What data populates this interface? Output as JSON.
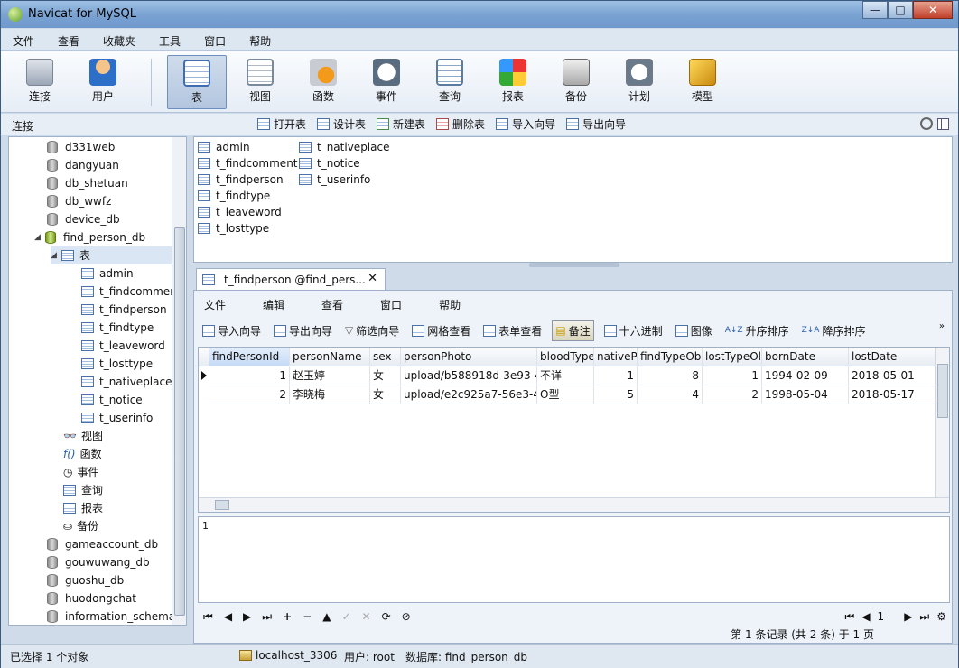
{
  "window": {
    "title": "Navicat for MySQL",
    "minimize": "—",
    "maximize": "□",
    "close": "✕"
  },
  "menu": [
    "文件",
    "查看",
    "收藏夹",
    "工具",
    "窗口",
    "帮助"
  ],
  "toolbar": {
    "connect": "连接",
    "user": "用户",
    "table": "表",
    "view": "视图",
    "function": "函数",
    "event": "事件",
    "query": "查询",
    "report": "报表",
    "backup": "备份",
    "schedule": "计划",
    "model": "模型"
  },
  "conn_bar": {
    "title": "连接",
    "tools": [
      "打开表",
      "设计表",
      "新建表",
      "删除表",
      "导入向导",
      "导出向导"
    ]
  },
  "sidebar": {
    "databases_top": [
      "d331web",
      "dangyuan",
      "db_shetuan",
      "db_wwfz",
      "device_db"
    ],
    "open_db": "find_person_db",
    "tables_node": "表",
    "tables": [
      "admin",
      "t_findcomment",
      "t_findperson",
      "t_findtype",
      "t_leaveword",
      "t_losttype",
      "t_nativeplace",
      "t_notice",
      "t_userinfo"
    ],
    "other_nodes": [
      "视图",
      "函数",
      "事件",
      "查询",
      "报表",
      "备份"
    ],
    "databases_bottom": [
      "gameaccount_db",
      "gouwuwang_db",
      "guoshu_db",
      "huodongchat",
      "information_schema"
    ]
  },
  "objects": {
    "col1": [
      "admin",
      "t_findcomment",
      "t_findperson",
      "t_findtype",
      "t_leaveword",
      "t_losttype"
    ],
    "col2": [
      "t_nativeplace",
      "t_notice",
      "t_userinfo"
    ]
  },
  "tab": {
    "label": "t_findperson @find_pers...",
    "close": "✕"
  },
  "data_menu": [
    "文件",
    "编辑",
    "查看",
    "窗口",
    "帮助"
  ],
  "data_tools": [
    "导入向导",
    "导出向导",
    "筛选向导",
    "网格查看",
    "表单查看",
    "备注",
    "十六进制",
    "图像",
    "升序排序",
    "降序排序"
  ],
  "grid": {
    "columns": [
      "findPersonId",
      "personName",
      "sex",
      "personPhoto",
      "bloodType",
      "nativePl",
      "findTypeOb",
      "lostTypeOl",
      "bornDate",
      "lostDate"
    ],
    "rows": [
      [
        "1",
        "赵玉婷",
        "女",
        "upload/b588918d-3e93-4",
        "不详",
        "1",
        "8",
        "1",
        "1994-02-09",
        "2018-05-01"
      ],
      [
        "2",
        "李晓梅",
        "女",
        "upload/e2c925a7-56e3-4",
        "O型",
        "5",
        "4",
        "2",
        "1998-05-04",
        "2018-05-17"
      ]
    ]
  },
  "memo": "1",
  "nav": {
    "buttons": [
      "⏮",
      "◀",
      "▶",
      "⏭",
      "+",
      "−",
      "▲",
      "✓",
      "✕",
      "⟳",
      "⊘"
    ],
    "page": "1"
  },
  "page_status": "第 1 条记录 (共 2 条) 于 1 页",
  "status": {
    "selection": "已选择 1 个对象",
    "host": "localhost_3306",
    "user": "用户: root",
    "database": "数据库: find_person_db"
  }
}
